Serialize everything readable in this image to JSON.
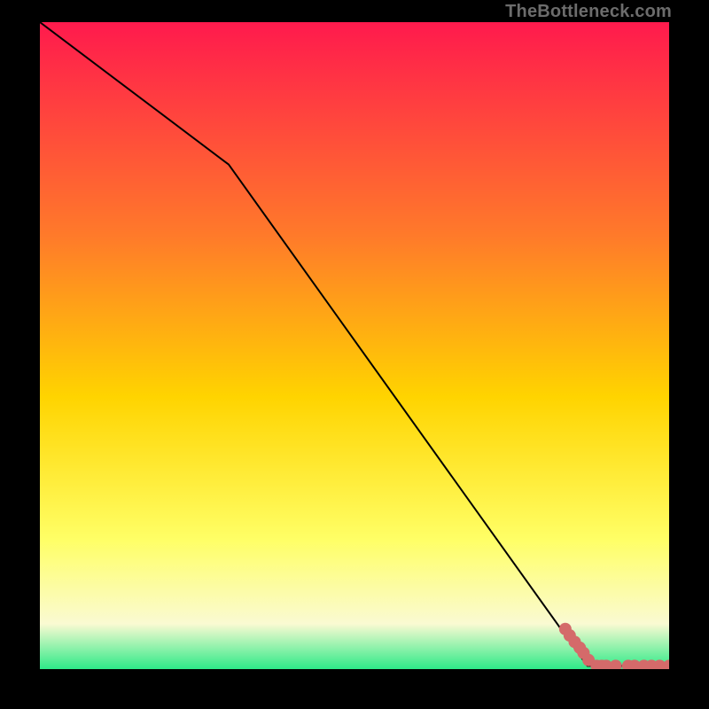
{
  "attribution": "TheBottleneck.com",
  "colors": {
    "bg_black": "#000000",
    "curve_black": "#000000",
    "marker": "#d46a6a",
    "grad_top": "#ff1a4d",
    "grad_mid1": "#ff7a2a",
    "grad_mid2": "#ffd400",
    "grad_mid3": "#ffff66",
    "grad_mid4": "#fafad2",
    "grad_bottom": "#2eea88"
  },
  "chart_data": {
    "type": "line",
    "title": "",
    "xlabel": "",
    "ylabel": "",
    "xlim": [
      0,
      100
    ],
    "ylim": [
      0,
      100
    ],
    "series": [
      {
        "name": "curve",
        "x": [
          0,
          30,
          87,
          100
        ],
        "y": [
          100,
          78,
          0.5,
          0.5
        ]
      },
      {
        "name": "markers",
        "x": [
          83.5,
          84.2,
          85.0,
          85.8,
          86.4,
          87.2,
          88.5,
          89.3,
          90.0,
          91.5,
          93.5,
          94.5,
          96.0,
          97.2,
          98.5,
          100.0
        ],
        "y": [
          6.2,
          5.2,
          4.2,
          3.3,
          2.5,
          1.4,
          0.5,
          0.5,
          0.5,
          0.5,
          0.5,
          0.5,
          0.5,
          0.5,
          0.5,
          0.5
        ]
      }
    ],
    "gradient_stops": [
      {
        "pct": 0.0,
        "name": "grad_top"
      },
      {
        "pct": 0.33,
        "name": "grad_mid1"
      },
      {
        "pct": 0.58,
        "name": "grad_mid2"
      },
      {
        "pct": 0.8,
        "name": "grad_mid3"
      },
      {
        "pct": 0.93,
        "name": "grad_mid4"
      },
      {
        "pct": 1.0,
        "name": "grad_bottom"
      }
    ]
  }
}
